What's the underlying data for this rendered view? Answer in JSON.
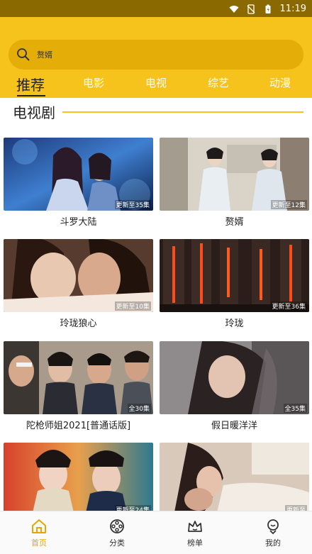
{
  "status_bar": {
    "time": "11:19",
    "bg_color": "#8a6a00"
  },
  "header": {
    "bg_color": "#f6c21c"
  },
  "search": {
    "value": "赘婿"
  },
  "tabs": [
    {
      "label": "推荐"
    },
    {
      "label": "电影"
    },
    {
      "label": "电视"
    },
    {
      "label": "综艺"
    },
    {
      "label": "动漫"
    }
  ],
  "section": {
    "title": "电视剧"
  },
  "cards": [
    {
      "title": "斗罗大陆",
      "badge": "更新至35集"
    },
    {
      "title": "赘婿",
      "badge": "更新至12集"
    },
    {
      "title": "玲珑狼心",
      "badge": "更新至10集"
    },
    {
      "title": "玲珑",
      "badge": "更新至36集"
    },
    {
      "title": "陀枪师姐2021[普通话版]",
      "badge": "全30集"
    },
    {
      "title": "假日暖洋洋",
      "badge": "全35集"
    },
    {
      "title": "",
      "badge": "更新至24集"
    },
    {
      "title": "",
      "badge": "更新至"
    }
  ],
  "bottom_nav": [
    {
      "label": "首页",
      "icon": "home-icon"
    },
    {
      "label": "分类",
      "icon": "film-reel-icon"
    },
    {
      "label": "榜单",
      "icon": "crown-icon"
    },
    {
      "label": "我的",
      "icon": "profile-icon"
    }
  ],
  "accent_color": "#e4a800"
}
